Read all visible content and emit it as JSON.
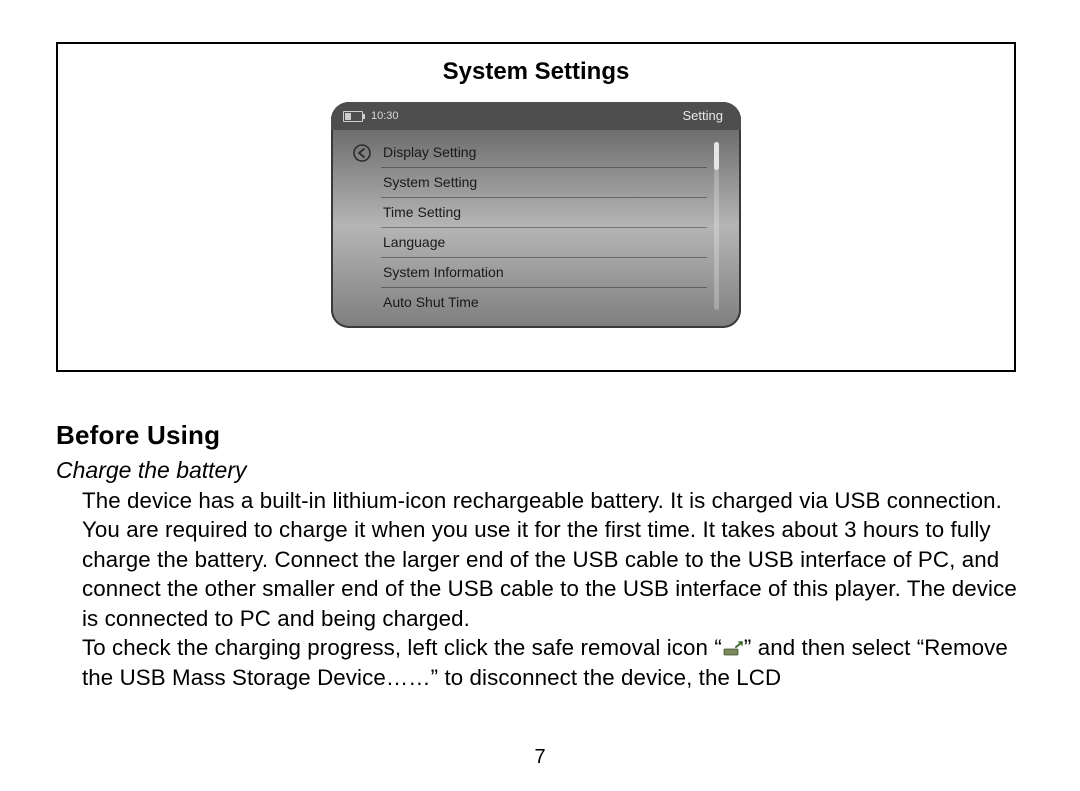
{
  "frame": {
    "title": "System Settings"
  },
  "device": {
    "status": {
      "time": "10:30",
      "screen_title": "Setting"
    },
    "menu_items": [
      "Display Setting",
      "System Setting",
      "Time Setting",
      "Language",
      "System Information",
      "Auto Shut Time"
    ]
  },
  "section": {
    "heading": "Before Using",
    "subheading": "Charge the battery"
  },
  "body": {
    "p1a": "The device has a built-in lithium-icon rechargeable battery. It is charged via USB connection. You are required to charge it when you use it for the first time. It takes about 3 hours to fully charge the battery. Connect the larger end of the USB cable to the USB interface of PC, and connect the other smaller end of the USB cable to the USB interface of this player. The device is connected to PC and being charged.",
    "p2a": "To check the charging progress, left click the safe removal icon “",
    "p2b": "” and then select “Remove the USB Mass Storage Device……” to disconnect the device, the LCD"
  },
  "page_number": "7"
}
